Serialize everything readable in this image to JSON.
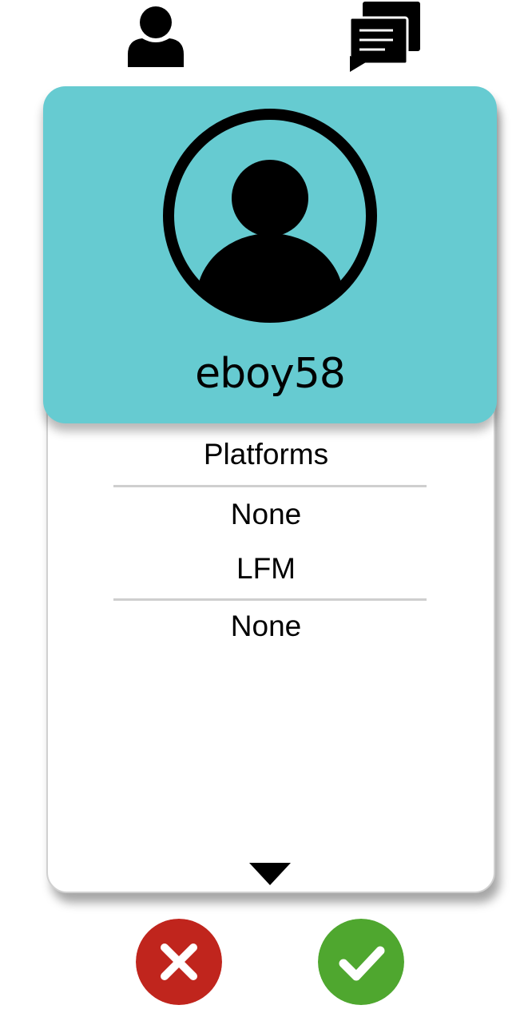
{
  "nav": {
    "profile_icon": "person-icon",
    "messages_icon": "chat-icon"
  },
  "profile": {
    "username": "eboy58",
    "avatar_icon": "user-circle-icon"
  },
  "sections": {
    "platforms_heading": "Platforms",
    "platforms_value": "None",
    "lfm_heading": "LFM",
    "lfm_value": "None"
  },
  "actions": {
    "expand_icon": "caret-down-icon",
    "reject_icon": "close-icon",
    "accept_icon": "check-icon"
  },
  "colors": {
    "header_bg": "#66cbd1",
    "reject": "#c0251d",
    "accept": "#4fa72f"
  }
}
